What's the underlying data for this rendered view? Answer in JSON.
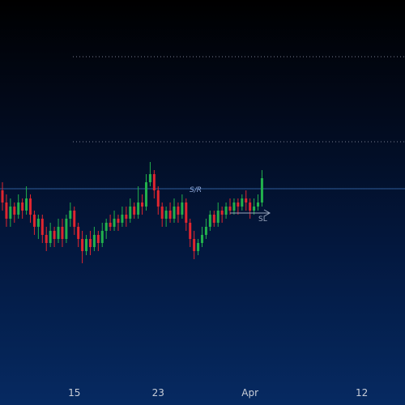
{
  "colors": {
    "up": "#22b14c",
    "down": "#e0262f",
    "sr_line": "#3a6fb5",
    "dotted": "#7a8092",
    "arrow": "#9aa6bd",
    "x_label": "#c9ced8"
  },
  "annotations": {
    "sr_label": "S/R",
    "sl_label": "SL"
  },
  "chart_data": {
    "type": "candlestick",
    "x_tick_labels": [
      "15",
      "23",
      "Apr",
      "12"
    ],
    "price_scale": {
      "ylim": [
        0,
        100
      ],
      "visible": false
    },
    "horizontal_levels": [
      {
        "name": "dotted-upper",
        "value": 86.0,
        "style": "dotted"
      },
      {
        "name": "dotted-lower",
        "value": 65.0,
        "style": "dotted"
      },
      {
        "name": "sr",
        "value": 53.4,
        "style": "solid"
      }
    ],
    "tick_positions_index": [
      18,
      39,
      62,
      90
    ],
    "candles": [
      [
        53,
        50,
        55,
        48
      ],
      [
        50,
        46,
        52,
        44
      ],
      [
        46,
        49,
        51,
        44
      ],
      [
        49,
        47,
        50,
        45
      ],
      [
        47,
        50,
        52,
        46
      ],
      [
        50,
        48,
        51,
        46
      ],
      [
        48,
        51,
        54,
        47
      ],
      [
        51,
        47,
        52,
        45
      ],
      [
        47,
        44,
        48,
        42
      ],
      [
        44,
        46,
        47,
        41
      ],
      [
        46,
        42,
        47,
        40
      ],
      [
        42,
        40,
        44,
        38
      ],
      [
        40,
        43,
        45,
        39
      ],
      [
        43,
        41,
        44,
        39
      ],
      [
        41,
        44,
        46,
        40
      ],
      [
        44,
        41,
        46,
        39
      ],
      [
        41,
        46,
        47,
        40
      ],
      [
        46,
        48,
        50,
        44
      ],
      [
        48,
        44,
        49,
        42
      ],
      [
        44,
        41,
        45,
        39
      ],
      [
        41,
        38,
        43,
        35
      ],
      [
        38,
        41,
        42,
        37
      ],
      [
        41,
        39,
        43,
        37
      ],
      [
        39,
        42,
        44,
        38
      ],
      [
        42,
        40,
        43,
        38
      ],
      [
        40,
        43,
        45,
        39
      ],
      [
        43,
        45,
        46,
        41
      ],
      [
        45,
        44,
        47,
        43
      ],
      [
        44,
        46,
        48,
        43
      ],
      [
        46,
        45,
        47,
        43
      ],
      [
        45,
        47,
        49,
        44
      ],
      [
        47,
        46,
        49,
        44
      ],
      [
        46,
        49,
        51,
        45
      ],
      [
        49,
        47,
        50,
        46
      ],
      [
        47,
        50,
        54,
        46
      ],
      [
        50,
        49,
        52,
        47
      ],
      [
        49,
        55,
        57,
        48
      ],
      [
        55,
        57,
        60,
        54
      ],
      [
        57,
        53,
        58,
        51
      ],
      [
        53,
        49,
        54,
        47
      ],
      [
        49,
        46,
        50,
        44
      ],
      [
        46,
        48,
        49,
        44
      ],
      [
        48,
        46,
        50,
        45
      ],
      [
        46,
        49,
        51,
        45
      ],
      [
        49,
        47,
        50,
        45
      ],
      [
        47,
        50,
        52,
        46
      ],
      [
        50,
        45,
        51,
        43
      ],
      [
        45,
        41,
        46,
        39
      ],
      [
        41,
        38,
        43,
        36
      ],
      [
        38,
        40,
        41,
        37
      ],
      [
        40,
        42,
        44,
        39
      ],
      [
        42,
        44,
        46,
        41
      ],
      [
        44,
        47,
        48,
        43
      ],
      [
        47,
        45,
        48,
        44
      ],
      [
        45,
        48,
        50,
        44
      ],
      [
        48,
        47,
        49,
        45
      ],
      [
        47,
        49,
        50,
        46
      ],
      [
        49,
        48,
        51,
        47
      ],
      [
        48,
        50,
        51,
        47
      ],
      [
        50,
        49,
        51,
        47
      ],
      [
        49,
        51,
        52,
        48
      ],
      [
        51,
        50,
        53,
        48
      ],
      [
        50,
        48,
        51,
        46
      ],
      [
        48,
        49,
        51,
        47
      ],
      [
        49,
        50,
        52,
        48
      ],
      [
        50,
        56,
        58,
        49
      ]
    ]
  }
}
